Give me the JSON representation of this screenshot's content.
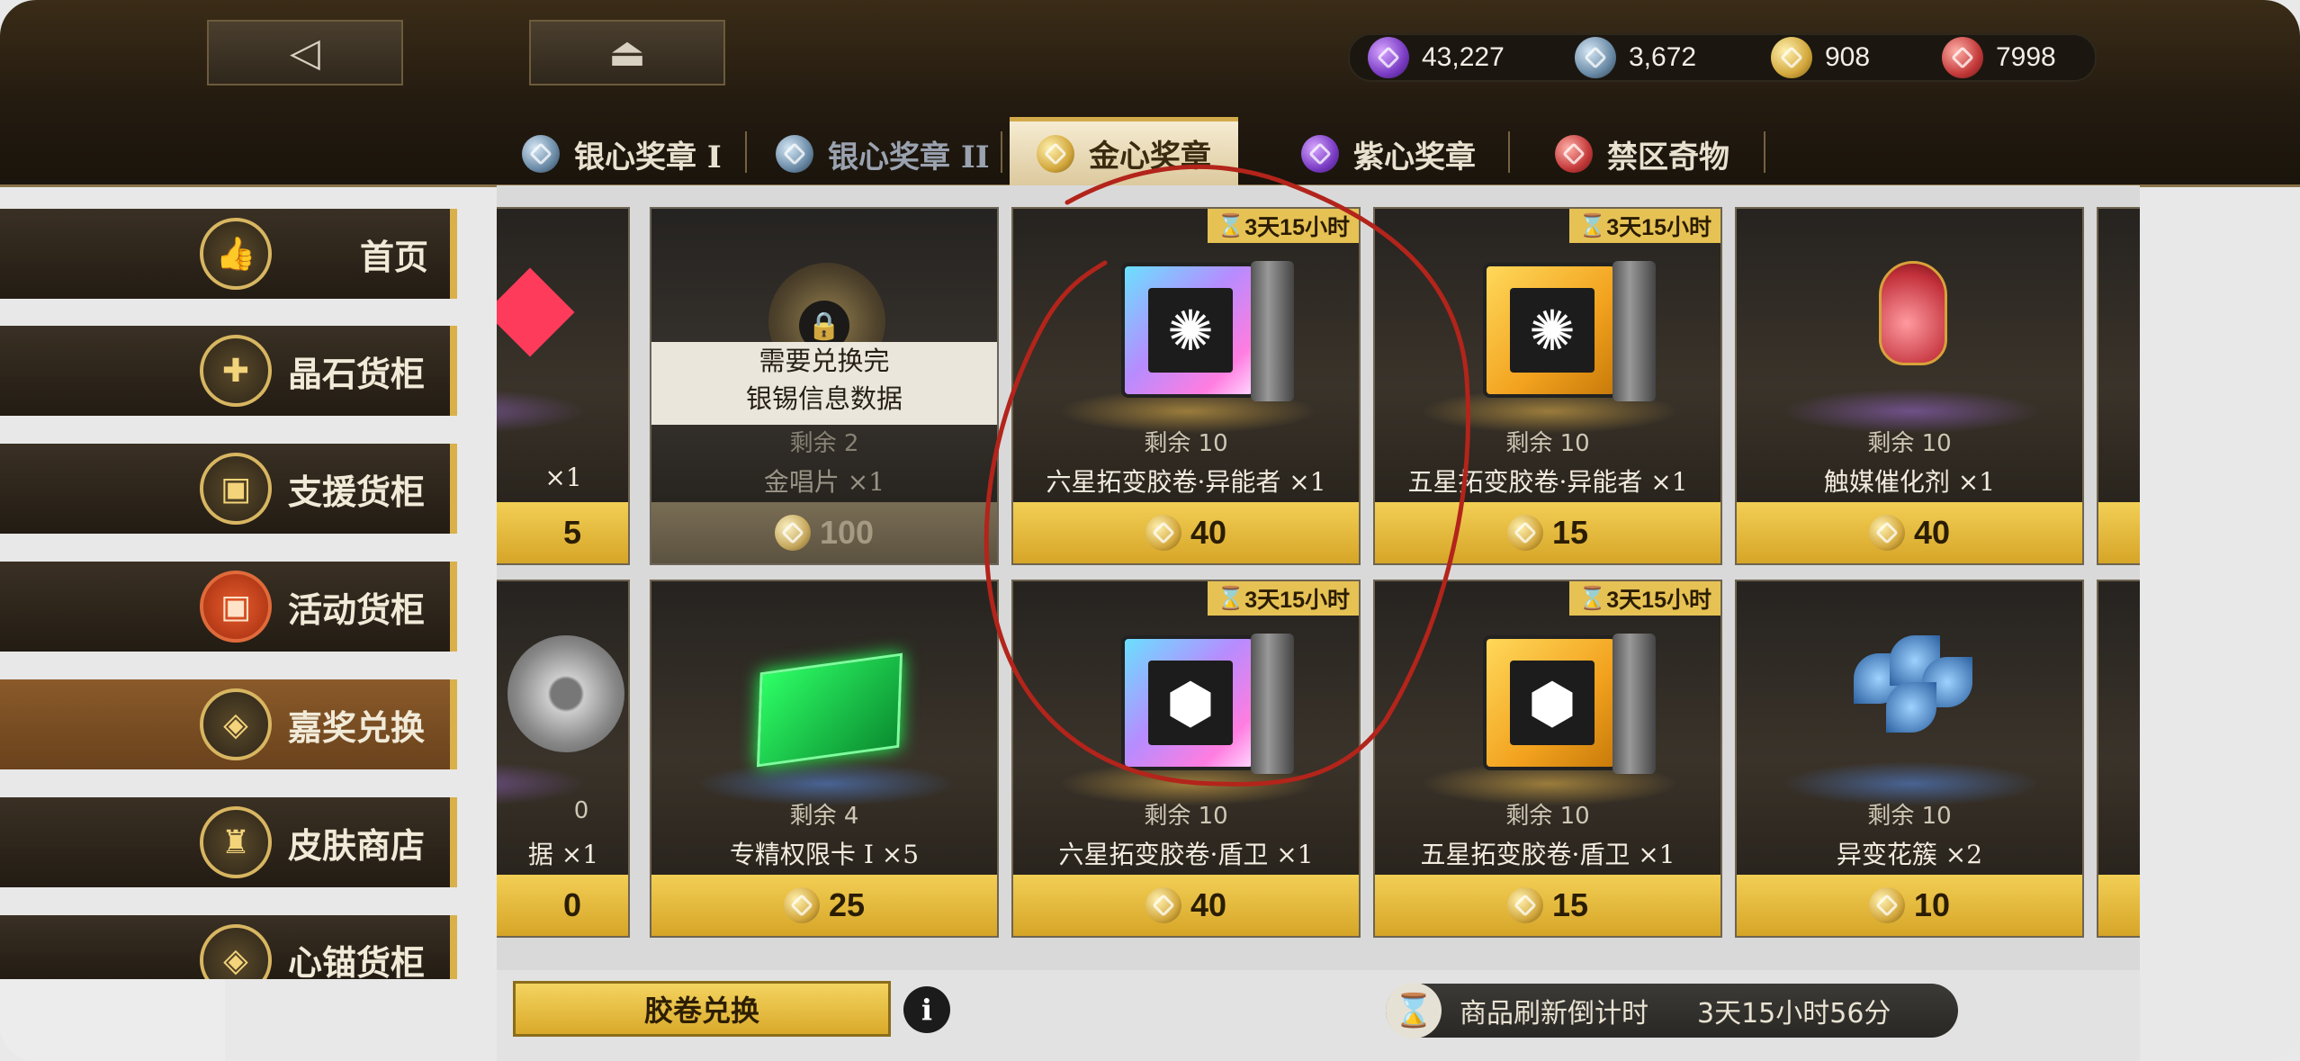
{
  "nav": {
    "back_icon": "◁",
    "home_icon": "⏏"
  },
  "currencies": [
    {
      "icon": "purple-heart-medal",
      "value": "43,227"
    },
    {
      "icon": "silver-heart-medal",
      "value": "3,672"
    },
    {
      "icon": "gold-heart-medal",
      "value": "908"
    },
    {
      "icon": "red-forbidden-curio",
      "value": "7998"
    }
  ],
  "tabs": [
    {
      "label": "银心奖章 I"
    },
    {
      "label": "银心奖章 II"
    },
    {
      "label": "金心奖章"
    },
    {
      "label": "紫心奖章"
    },
    {
      "label": "禁区奇物"
    }
  ],
  "sidebar": [
    {
      "label": "首页"
    },
    {
      "label": "晶石货柜"
    },
    {
      "label": "支援货柜"
    },
    {
      "label": "活动货柜"
    },
    {
      "label": "嘉奖兑换"
    },
    {
      "label": "皮肤商店"
    },
    {
      "label": "心锚货柜"
    }
  ],
  "cards": {
    "r1c0": {
      "name": "×1",
      "price": "5"
    },
    "r1c1": {
      "lock_line1": "需要兑换完",
      "lock_line2": "银锡信息数据",
      "remain": "剩余 2",
      "name": "金唱片 ×1",
      "price": "100"
    },
    "r1c2": {
      "timer": "3天15小时",
      "remain": "剩余 10",
      "name": "六星拓变胶卷·异能者 ×1",
      "price": "40"
    },
    "r1c3": {
      "timer": "3天15小时",
      "remain": "剩余 10",
      "name": "五星拓变胶卷·异能者 ×1",
      "price": "15"
    },
    "r1c4": {
      "remain": "剩余 10",
      "name": "触媒催化剂 ×1",
      "price": "40"
    },
    "r2c0": {
      "remain": "0",
      "name": "据 ×1",
      "price": "0"
    },
    "r2c1": {
      "remain": "剩余 4",
      "name": "专精权限卡 I ×5",
      "price": "25"
    },
    "r2c2": {
      "timer": "3天15小时",
      "remain": "剩余 10",
      "name": "六星拓变胶卷·盾卫 ×1",
      "price": "40"
    },
    "r2c3": {
      "timer": "3天15小时",
      "remain": "剩余 10",
      "name": "五星拓变胶卷·盾卫 ×1",
      "price": "15"
    },
    "r2c4": {
      "remain": "剩余 10",
      "name": "异变花簇 ×2",
      "price": "10"
    }
  },
  "bottom": {
    "film_exchange_label": "胶卷兑换",
    "info_icon": "i",
    "refresh_label": "商品刷新倒计时",
    "refresh_value": "3天15小时56分"
  },
  "colors": {
    "accent_gold": "#e6c255",
    "annotation_red": "#b3241b"
  }
}
